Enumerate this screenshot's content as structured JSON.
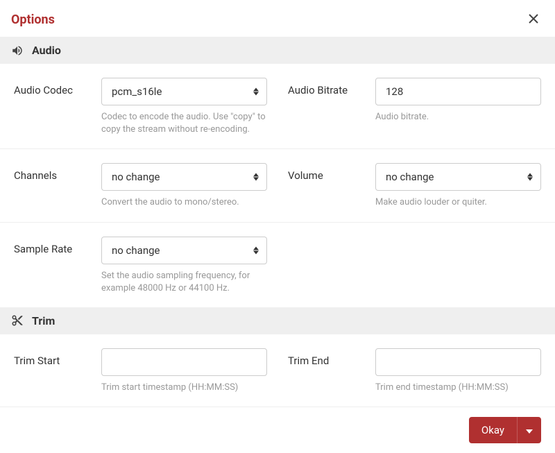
{
  "modal": {
    "title": "Options"
  },
  "sections": {
    "audio": {
      "title": "Audio",
      "fields": {
        "codec": {
          "label": "Audio Codec",
          "value": "pcm_s16le",
          "help": "Codec to encode the audio. Use \"copy\" to copy the stream without re-encoding."
        },
        "bitrate": {
          "label": "Audio Bitrate",
          "value": "128",
          "help": "Audio bitrate."
        },
        "channels": {
          "label": "Channels",
          "value": "no change",
          "help": "Convert the audio to mono/stereo."
        },
        "volume": {
          "label": "Volume",
          "value": "no change",
          "help": "Make audio louder or quiter."
        },
        "sampleRate": {
          "label": "Sample Rate",
          "value": "no change",
          "help": "Set the audio sampling frequency, for example 48000 Hz or 44100 Hz."
        }
      }
    },
    "trim": {
      "title": "Trim",
      "fields": {
        "start": {
          "label": "Trim Start",
          "value": "",
          "help": "Trim start timestamp (HH:MM:SS)"
        },
        "end": {
          "label": "Trim End",
          "value": "",
          "help": "Trim end timestamp (HH:MM:SS)"
        }
      }
    }
  },
  "footer": {
    "okay": "Okay"
  }
}
